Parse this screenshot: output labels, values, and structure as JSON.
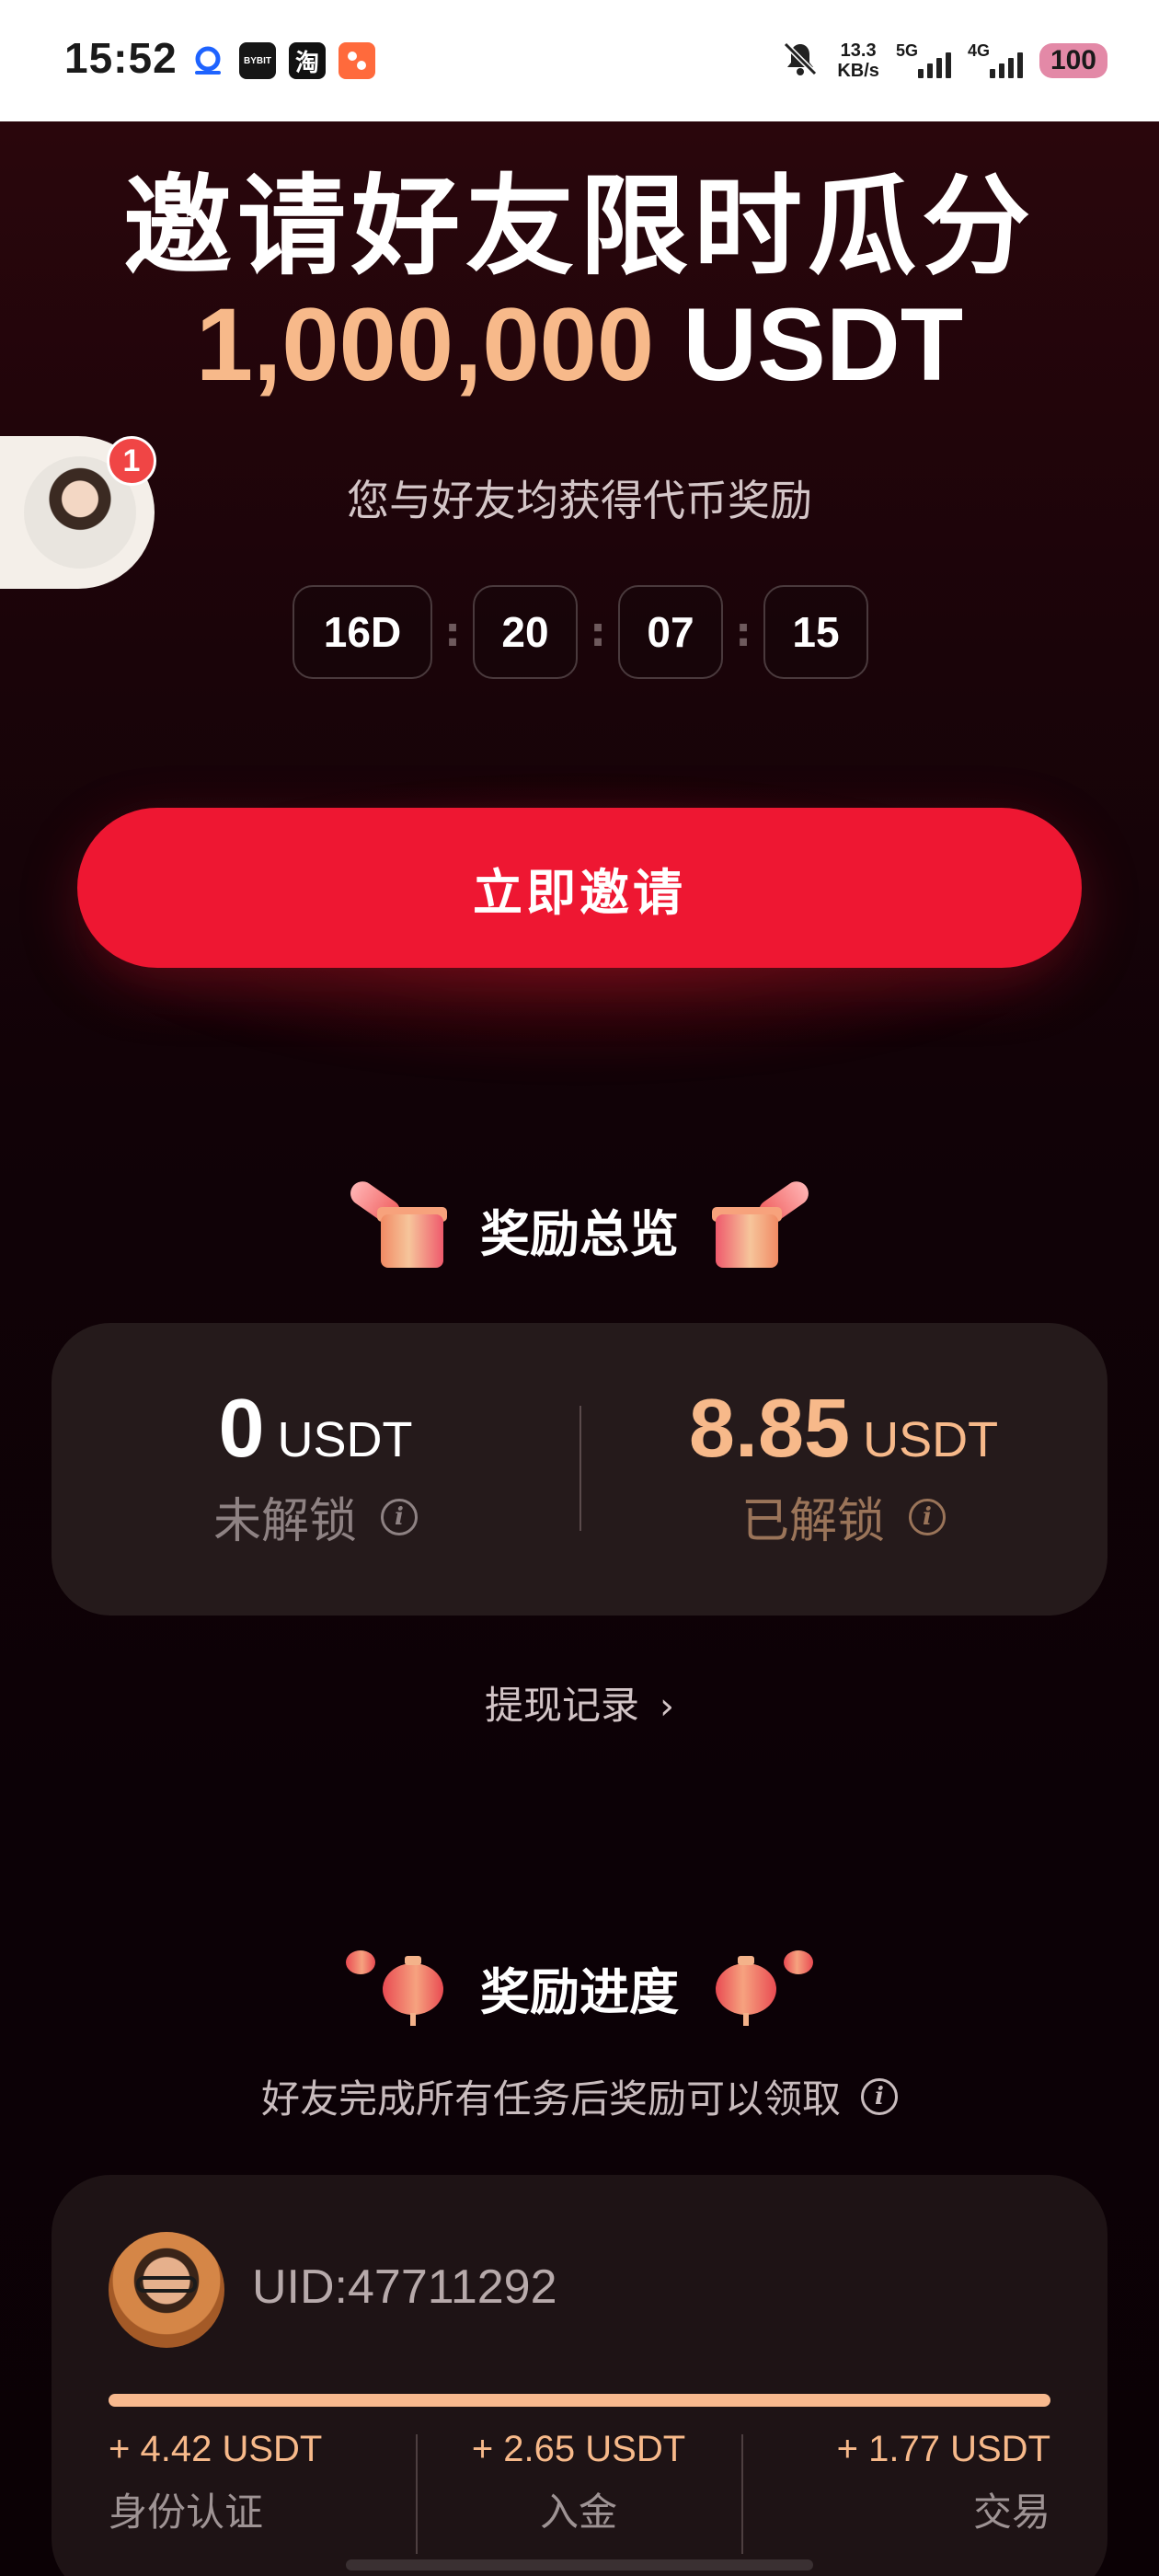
{
  "status_bar": {
    "time": "15:52",
    "net_speed_value": "13.3",
    "net_speed_unit": "KB/s",
    "sim1": "5G",
    "sim2": "4G",
    "battery": "100",
    "apps": [
      {
        "name": "tiktok-app",
        "label": "",
        "color": "#1e63ff"
      },
      {
        "name": "bybit-app",
        "label": "BYBIT",
        "color": "#161616"
      },
      {
        "name": "taobao-app",
        "label": "淘",
        "color": "#111111"
      },
      {
        "name": "photo-app",
        "label": "",
        "color": "#ff6a3c"
      }
    ]
  },
  "hero": {
    "title": "邀请好友限时瓜分",
    "amount": "1,000,000",
    "currency": "USDT",
    "subtitle": "您与好友均获得代币奖励",
    "countdown": {
      "days": "16D",
      "hours": "20",
      "minutes": "07",
      "seconds": "15",
      "separator": ":"
    },
    "invite_button": "立即邀请"
  },
  "floating_avatar": {
    "badge_count": "1"
  },
  "overview": {
    "heading": "奖励总览",
    "locked": {
      "amount": "0",
      "unit": "USDT",
      "label": "未解锁"
    },
    "unlocked": {
      "amount": "8.85",
      "unit": "USDT",
      "label": "已解锁"
    },
    "withdraw_link": "提现记录",
    "info_glyph": "i",
    "chevron": "›"
  },
  "progress": {
    "heading": "奖励进度",
    "subtitle": "好友完成所有任务后奖励可以领取",
    "friend": {
      "uid": "UID:47711292",
      "progress_fraction": 1.0,
      "tasks": [
        {
          "amount": "+ 4.42 USDT",
          "name": "身份认证"
        },
        {
          "amount": "+ 2.65 USDT",
          "name": "入金"
        },
        {
          "amount": "+ 1.77 USDT",
          "name": "交易"
        }
      ]
    }
  },
  "colors": {
    "accent_red": "#ee1732",
    "accent_peach": "#f7b98a",
    "card_bg": "#251a1b",
    "page_bg": "#0d0206"
  }
}
